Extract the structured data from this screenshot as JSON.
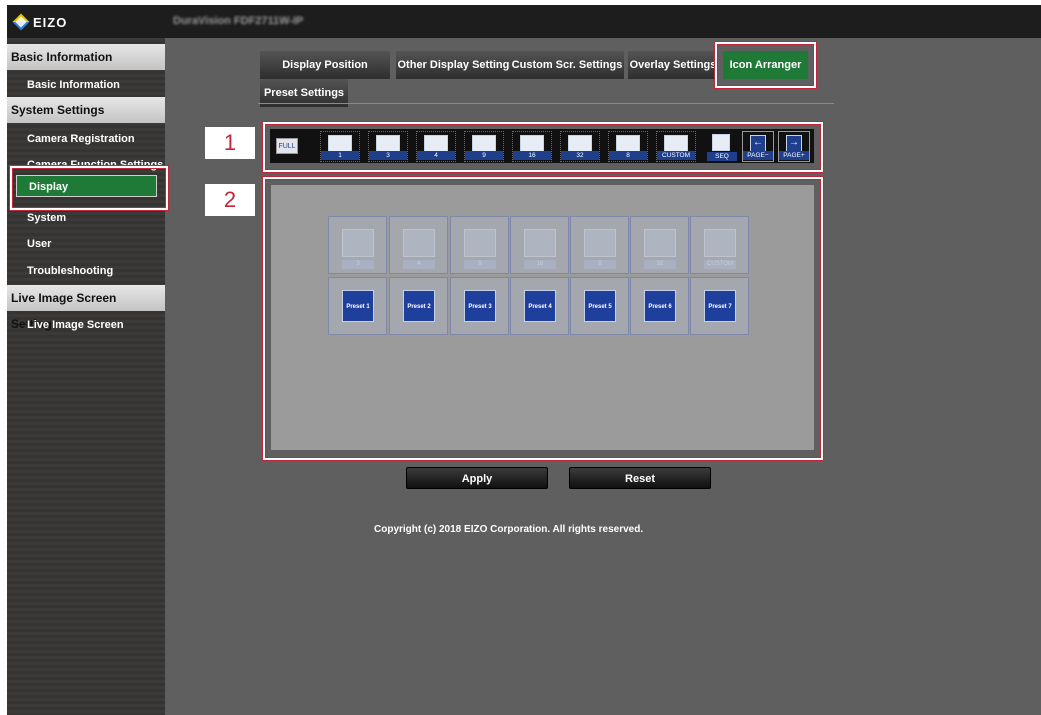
{
  "brand": {
    "logo_text": "EIZO",
    "model_name": "DuraVision FDF2711W-IP"
  },
  "sidebar": {
    "sections": [
      {
        "title": "Basic Information",
        "items": [
          "Basic Information"
        ]
      },
      {
        "title": "System Settings",
        "items": [
          "Camera Registration",
          "Camera Function Settings",
          "Display",
          "System",
          "User",
          "Troubleshooting"
        ]
      },
      {
        "title": "Live Image Screen Settings",
        "items": [
          "Live Image Screen"
        ]
      }
    ],
    "active_item": "Display"
  },
  "tabs": {
    "row1": [
      "Display Position Settings",
      "Other Display Settings",
      "Custom Scr. Settings",
      "Overlay Settings",
      "Icon Arranger"
    ],
    "row2": [
      "Preset Settings"
    ],
    "active": "Icon Arranger"
  },
  "callouts": [
    "1",
    "2"
  ],
  "toolbar": {
    "full": "FULL",
    "layouts": [
      "1",
      "3",
      "4",
      "9",
      "16",
      "32",
      "8",
      "CUSTOM"
    ],
    "seq": "SEQ",
    "page_minus": "PAGE−",
    "page_plus": "PAGE+"
  },
  "arranger": {
    "row1": [
      "3",
      "4",
      "9",
      "16",
      "8",
      "32",
      "CUSTOM"
    ],
    "row2": [
      "Preset 1",
      "Preset 2",
      "Preset 3",
      "Preset 4",
      "Preset 5",
      "Preset 6",
      "Preset 7"
    ]
  },
  "buttons": {
    "apply": "Apply",
    "reset": "Reset"
  },
  "footer": {
    "copyright": "Copyright (c) 2018 EIZO Corporation. All rights reserved."
  },
  "colors": {
    "active_green": "#1f7a37",
    "callout_red": "#c0283a",
    "tile_blue": "#1f3f9c"
  }
}
